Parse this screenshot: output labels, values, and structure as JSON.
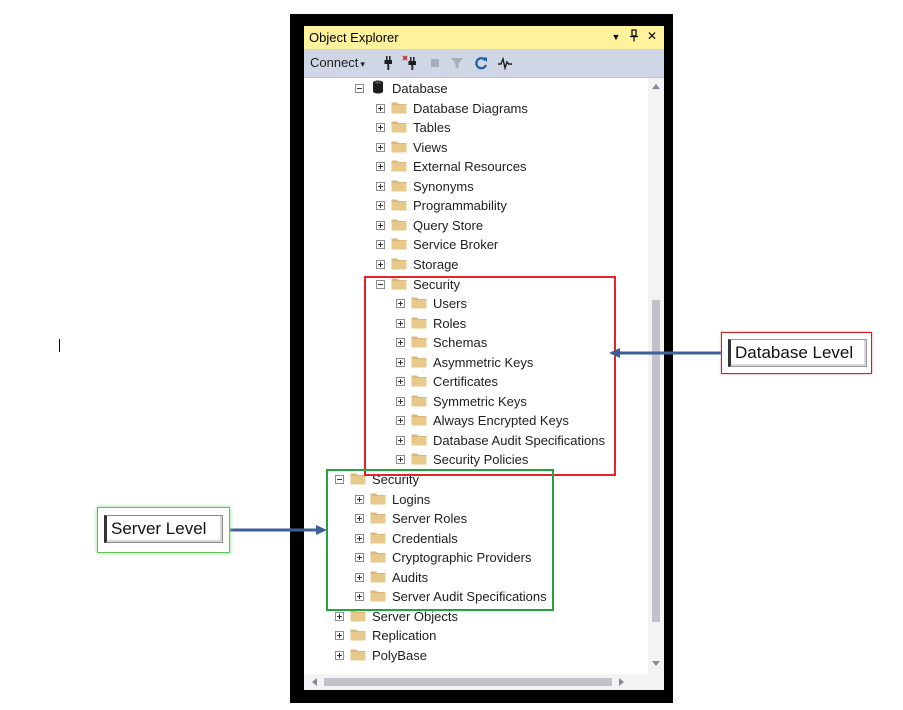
{
  "window": {
    "title": "Object Explorer",
    "dropdown_glyph": "▼",
    "pin_glyph": "ᵖ",
    "close_glyph": "✕"
  },
  "toolbar": {
    "connect_label": "Connect",
    "connect_caret": "▾",
    "icons": [
      "connect-plug-icon",
      "disconnect-plug-icon",
      "stop-icon",
      "filter-icon",
      "refresh-icon",
      "activity-monitor-icon"
    ]
  },
  "tree": {
    "database": {
      "label": "Database",
      "children": [
        "Database Diagrams",
        "Tables",
        "Views",
        "External Resources",
        "Synonyms",
        "Programmability",
        "Query Store",
        "Service Broker",
        "Storage"
      ],
      "security": {
        "label": "Security",
        "children": [
          "Users",
          "Roles",
          "Schemas",
          "Asymmetric Keys",
          "Certificates",
          "Symmetric Keys",
          "Always Encrypted Keys",
          "Database Audit Specifications",
          "Security Policies"
        ]
      }
    },
    "server_security": {
      "label": "Security",
      "children": [
        "Logins",
        "Server Roles",
        "Credentials",
        "Cryptographic Providers",
        "Audits",
        "Server Audit Specifications"
      ]
    },
    "server_nodes": [
      "Server Objects",
      "Replication",
      "PolyBase"
    ]
  },
  "callouts": {
    "database_level": "Database Level",
    "server_level": "Server Level"
  },
  "colors": {
    "title_bar": "#fff29d",
    "toolbar": "#cfd6e5",
    "folder": "#dcb67a",
    "database_box": "#e2242a",
    "server_box": "#22a63c",
    "arrow": "#3f5f9a"
  }
}
